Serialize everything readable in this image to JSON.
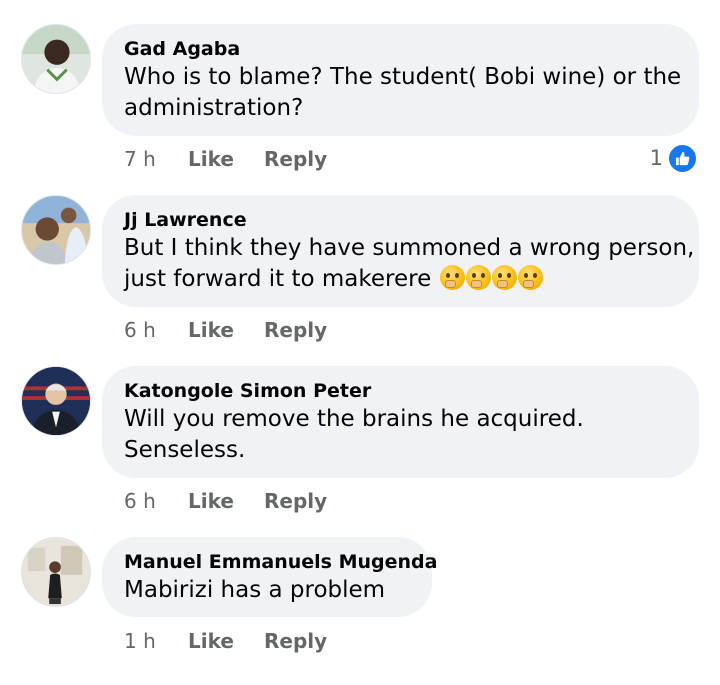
{
  "comments": [
    {
      "author": "Gad Agaba",
      "text_lines": [
        "Who is to blame? The student( Bobi wine) or the",
        "administration?"
      ],
      "time": "7 h",
      "like_label": "Like",
      "reply_label": "Reply",
      "reaction_count": "1",
      "reaction_icon": "like-badge-icon"
    },
    {
      "author": "Jj Lawrence",
      "text_lines": [
        "But I think they have summoned a wrong person,",
        "just forward it to makerere"
      ],
      "emoji": "thinking-face-icon",
      "emoji_count": 4,
      "time": "6 h",
      "like_label": "Like",
      "reply_label": "Reply"
    },
    {
      "author": "Katongole Simon Peter",
      "text_lines": [
        "Will you remove the brains he acquired.",
        "Senseless."
      ],
      "time": "6 h",
      "like_label": "Like",
      "reply_label": "Reply"
    },
    {
      "author": "Manuel Emmanuels Mugenda",
      "text_lines": [
        "Mabirizi has a problem"
      ],
      "time": "1 h",
      "like_label": "Like",
      "reply_label": "Reply"
    }
  ],
  "colors": {
    "bubble": "#f0f2f5",
    "meta_text": "#65676b",
    "like_badge": "#1877f2"
  }
}
